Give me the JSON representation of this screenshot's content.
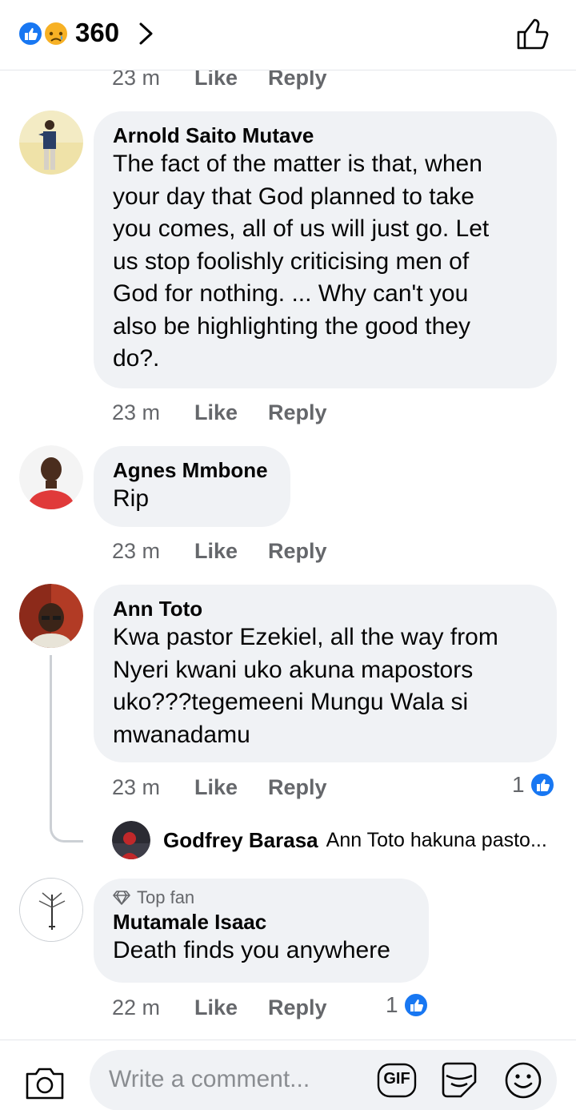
{
  "header": {
    "reaction_count": "360",
    "reaction_icons": [
      "like-icon",
      "sad-icon"
    ],
    "back_icon": "chevron-right-icon",
    "like_icon": "thumbs-up-outline-icon"
  },
  "previous_comment_actions": {
    "time": "23 m",
    "like_label": "Like",
    "reply_label": "Reply"
  },
  "comments": [
    {
      "author": "Arnold Saito Mutave",
      "lines": [
        "The fact of the matter is that, when",
        "your day that God planned to take",
        "you comes, all of us will just go. Let",
        "us stop foolishly criticising men of",
        "God for nothing. ... Why can't you",
        "also be highlighting the good they",
        "do?."
      ],
      "time": "23 m",
      "like_label": "Like",
      "reply_label": "Reply"
    },
    {
      "author": "Agnes Mmbone",
      "lines": [
        "Rip"
      ],
      "time": "23 m",
      "like_label": "Like",
      "reply_label": "Reply"
    },
    {
      "author": "Ann Toto",
      "lines": [
        "Kwa pastor Ezekiel, all the way from",
        "Nyeri kwani uko akuna mapostors",
        "uko???tegemeeni Mungu Wala si",
        "mwanadamu"
      ],
      "time": "23 m",
      "like_label": "Like",
      "reply_label": "Reply",
      "reactions": "1",
      "reply_preview": {
        "author": "Godfrey Barasa",
        "text": "Ann Toto hakuna pasto..."
      }
    },
    {
      "badge": "Top fan",
      "author": "Mutamale Isaac",
      "lines": [
        "Death finds you anywhere"
      ],
      "time": "22 m",
      "like_label": "Like",
      "reply_label": "Reply",
      "reactions": "1"
    }
  ],
  "composer": {
    "placeholder": "Write a comment...",
    "gif_label": "GIF",
    "camera_icon": "camera-icon",
    "sticker_icon": "sticker-icon",
    "emoji_icon": "emoji-icon"
  },
  "colors": {
    "facebook_blue": "#1877f2",
    "bubble_bg": "#f0f2f5",
    "secondary_text": "#65676b"
  }
}
